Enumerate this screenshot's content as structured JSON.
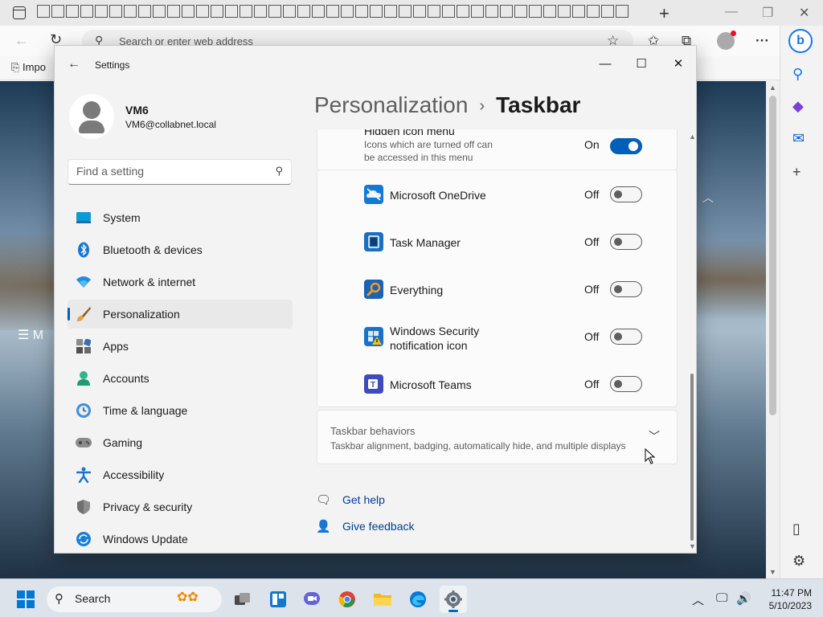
{
  "browser": {
    "address_placeholder": "Search or enter web address",
    "favorites_item": "Impo",
    "page_menu_letter": "M"
  },
  "settings": {
    "window_title": "Settings",
    "profile": {
      "name": "VM6",
      "email": "VM6@collabnet.local"
    },
    "search_placeholder": "Find a setting",
    "nav": [
      {
        "label": "System",
        "icon": "system-icon"
      },
      {
        "label": "Bluetooth & devices",
        "icon": "bluetooth-icon"
      },
      {
        "label": "Network & internet",
        "icon": "wifi-icon"
      },
      {
        "label": "Personalization",
        "icon": "brush-icon",
        "active": true
      },
      {
        "label": "Apps",
        "icon": "apps-icon"
      },
      {
        "label": "Accounts",
        "icon": "accounts-icon"
      },
      {
        "label": "Time & language",
        "icon": "clock-icon"
      },
      {
        "label": "Gaming",
        "icon": "gamepad-icon"
      },
      {
        "label": "Accessibility",
        "icon": "accessibility-icon"
      },
      {
        "label": "Privacy & security",
        "icon": "shield-icon"
      },
      {
        "label": "Windows Update",
        "icon": "update-icon"
      }
    ],
    "breadcrumb": {
      "parent": "Personalization",
      "separator": "›",
      "current": "Taskbar"
    },
    "hidden_icon_menu": {
      "title": "Hidden icon menu",
      "description_line1": "Icons which are turned off can",
      "description_line2": "be accessed in this menu",
      "state": "On"
    },
    "items": [
      {
        "label": "Microsoft OneDrive",
        "state": "Off",
        "icon": "onedrive-icon"
      },
      {
        "label": "Task Manager",
        "state": "Off",
        "icon": "task-manager-icon"
      },
      {
        "label": "Everything",
        "state": "Off",
        "icon": "everything-search-icon"
      },
      {
        "label_line1": "Windows Security",
        "label_line2": "notification icon",
        "state": "Off",
        "icon": "windows-security-icon"
      },
      {
        "label": "Microsoft Teams",
        "state": "Off",
        "icon": "teams-icon"
      }
    ],
    "behaviors": {
      "title": "Taskbar behaviors",
      "subtitle": "Taskbar alignment, badging, automatically hide, and multiple displays"
    },
    "links": {
      "help": "Get help",
      "feedback": "Give feedback"
    }
  },
  "taskbar": {
    "search_label": "Search",
    "time": "11:47 PM",
    "date": "5/10/2023"
  },
  "colors": {
    "accent": "#005fb8",
    "link": "#003e92",
    "window_bg": "#f3f3f3",
    "card_bg": "#fbfbfb"
  }
}
